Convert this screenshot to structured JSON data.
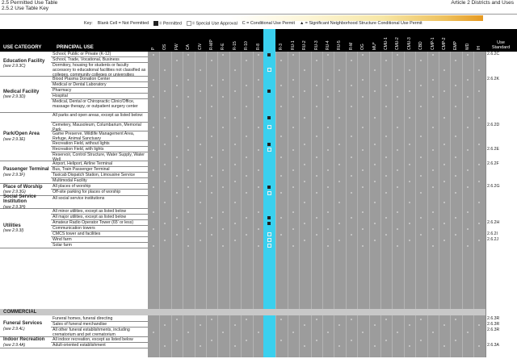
{
  "header": {
    "left_line1": "2.5 Permitted Use Table",
    "left_line2": "2.5.2 Use Table Key",
    "right": "Article 2 Districts and Uses"
  },
  "key": {
    "label": "Key:",
    "blank": "Blank Cell = Not Permitted",
    "permitted": "= Permitted",
    "special": "= Special Use Approval",
    "conditional": "C = Conditional Use Permit",
    "significant": "= Significant Neighborhood Structure Conditional Use Permit"
  },
  "table": {
    "col_use_category": "USE CATEGORY",
    "col_principal_use": "PRINCIPAL USE",
    "col_use_standard": "Use Standard",
    "zones": [
      "P",
      "OS",
      "FW",
      "CA",
      "CIV",
      "R-MP",
      "R-E",
      "R-15",
      "R-10",
      "R-8",
      "R-6",
      "R-3",
      "RU-1",
      "RU-2",
      "RU-3",
      "RU-4",
      "RU-5",
      "R-M",
      "OG",
      "MU*",
      "CMU-1",
      "CMU-2",
      "CMU-3",
      "CBD",
      "CMP-1",
      "CMP-2",
      "EMP",
      "WD",
      "IH"
    ],
    "highlight_zone": "R-6",
    "categories": [
      {
        "name": "Education Facility",
        "ref": "(see 2.9.3C)"
      },
      {
        "name": "Medical Facility",
        "ref": "(see 2.9.3D)"
      },
      {
        "name": "Park/Open Area",
        "ref": "(see 2.9.3E)"
      },
      {
        "name": "Passenger Terminal",
        "ref": "(see 2.9.3F)"
      },
      {
        "name": "Place of Worship",
        "ref": "(see 2.9.3G)"
      },
      {
        "name": "Social Service Institution",
        "ref": "(see 2.9.3H)"
      },
      {
        "name": "Utilities",
        "ref": "(see 2.9.3I)"
      },
      {
        "name": "Funeral Services",
        "ref": "(see 2.9.4L)"
      },
      {
        "name": "Indoor Recreation",
        "ref": "(see 2.9.4A)"
      }
    ],
    "section_commercial": "COMMERCIAL",
    "rows": [
      {
        "use": "School, Public or Private (K-12)",
        "std": "2.6.2C"
      },
      {
        "use": "School, Trade, Vocational, Business",
        "std": ""
      },
      {
        "use": "Dormitory, housing for students or faculty accessory to educational facilities not classified as colleges, community colleges or universities",
        "std": ""
      },
      {
        "use": "Blood Plasma Donation Center",
        "std": "2.6.2K"
      },
      {
        "use": "Medical or Dental Laboratory",
        "std": ""
      },
      {
        "use": "Pharmacy",
        "std": ""
      },
      {
        "use": "Hospital",
        "std": ""
      },
      {
        "use": "Medical, Dental or Chiropractic Clinic/Office, massage therapy, or outpatient surgery center",
        "std": ""
      },
      {
        "use": "All parks and open areas, except as listed below:",
        "std": ""
      },
      {
        "use": "Cemetery, Mausoleum, Columbarium, Memorial Park",
        "std": "2.6.2D"
      },
      {
        "use": "Game Preserve, Wildlife Management Area, Refuge, Animal Sanctuary",
        "std": ""
      },
      {
        "use": "Recreation Field, without lights",
        "std": ""
      },
      {
        "use": "Recreation Field, with lights",
        "std": "2.6.2E"
      },
      {
        "use": "Reservoir, Control Structure, Water Supply, Water Well",
        "std": ""
      },
      {
        "use": "Airport, Heliport, Airline Terminal",
        "std": "2.6.2F"
      },
      {
        "use": "Bus, Train Passenger Terminal",
        "std": ""
      },
      {
        "use": "Taxicab Dispatch Station, Limousine Service",
        "std": ""
      },
      {
        "use": "Multimodal Facility",
        "std": ""
      },
      {
        "use": "All places of worship",
        "std": "2.6.2G"
      },
      {
        "use": "Off-site parking for places of worship",
        "std": ""
      },
      {
        "use": "All social service institutions",
        "std": ""
      },
      {
        "use": "All minor utilities, except as listed below",
        "std": ""
      },
      {
        "use": "All major utilities, except as listed below",
        "std": ""
      },
      {
        "use": "Amateur Radio Operator Tower (65' or less)",
        "std": "2.6.2H"
      },
      {
        "use": "Communication towers",
        "std": ""
      },
      {
        "use": "CMCS tower and facilities",
        "std": "2.6.2I"
      },
      {
        "use": "Wind farm",
        "std": "2.6.2J"
      },
      {
        "use": "Solar farm",
        "std": ""
      },
      {
        "use": "Funeral homes, funeral directing",
        "std": "2.6.3R"
      },
      {
        "use": "Sales of funeral merchandise",
        "std": "2.6.3R"
      },
      {
        "use": "All other funeral establishments, including crematorium and pet crematorium",
        "std": "2.6.3R"
      },
      {
        "use": "All indoor recreation, except as listed below",
        "std": ""
      },
      {
        "use": "Adult-oriented establishment",
        "std": "2.6.3A"
      }
    ],
    "r6_marks": [
      "P",
      "",
      "C",
      "",
      "",
      "P",
      "",
      "",
      "P",
      "C",
      "",
      "P",
      "C",
      "",
      "",
      "",
      "",
      "",
      "P",
      "C",
      "",
      "",
      "P",
      "P",
      "",
      "C",
      "C",
      "C",
      "",
      "",
      "",
      "",
      ""
    ]
  }
}
